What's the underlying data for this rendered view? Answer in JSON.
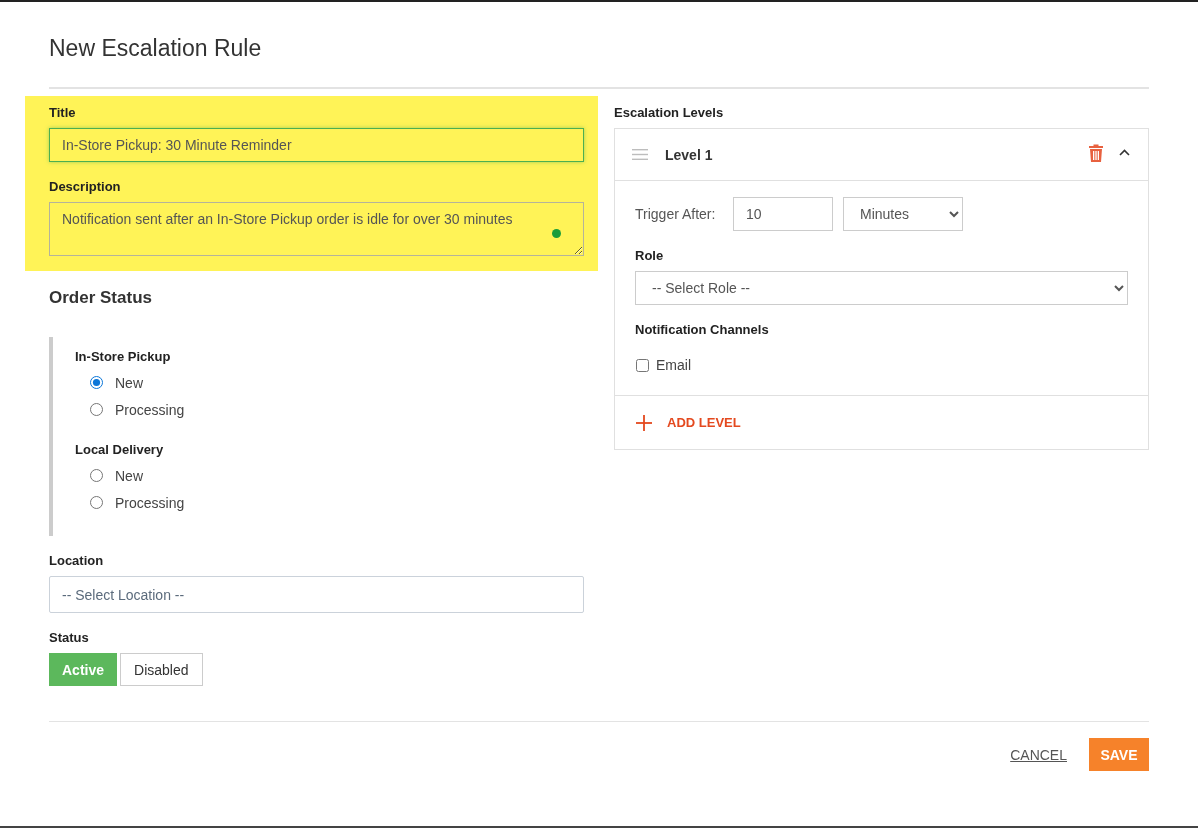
{
  "dialog": {
    "title": "New Escalation Rule"
  },
  "details": {
    "highlighted": true,
    "fields": [
      {
        "kind": "input",
        "label": "Title",
        "value": "In-Store Pickup: 30 Minute Reminder",
        "focused": true
      },
      {
        "kind": "textarea",
        "label": "Description",
        "value": "Notification sent after an In-Store Pickup order is idle for over 30 minutes",
        "focused": false
      }
    ]
  },
  "order_status": {
    "heading": "Order Status",
    "groups": [
      {
        "label": "In-Store Pickup",
        "options": [
          {
            "label": "New",
            "selected": true
          },
          {
            "label": "Processing",
            "selected": false
          }
        ]
      },
      {
        "label": "Local Delivery",
        "options": [
          {
            "label": "New",
            "selected": false
          },
          {
            "label": "Processing",
            "selected": false
          }
        ]
      }
    ]
  },
  "location": {
    "label": "Location",
    "placeholder": "-- Select Location --"
  },
  "status": {
    "label": "Status",
    "options": [
      {
        "label": "Active",
        "selected": true
      },
      {
        "label": "Disabled",
        "selected": false
      }
    ]
  },
  "escalation": {
    "heading": "Escalation Levels",
    "levels": [
      {
        "name": "Level 1",
        "expanded": true,
        "trigger_label": "Trigger After:",
        "trigger_value": "10",
        "trigger_unit": "Minutes",
        "role_label": "Role",
        "role_placeholder": "-- Select Role --",
        "channels_label": "Notification Channels",
        "channels": [
          {
            "label": "Email",
            "checked": false
          }
        ]
      }
    ],
    "add_label": "ADD LEVEL"
  },
  "actions": {
    "cancel": "CANCEL",
    "save": "SAVE"
  }
}
